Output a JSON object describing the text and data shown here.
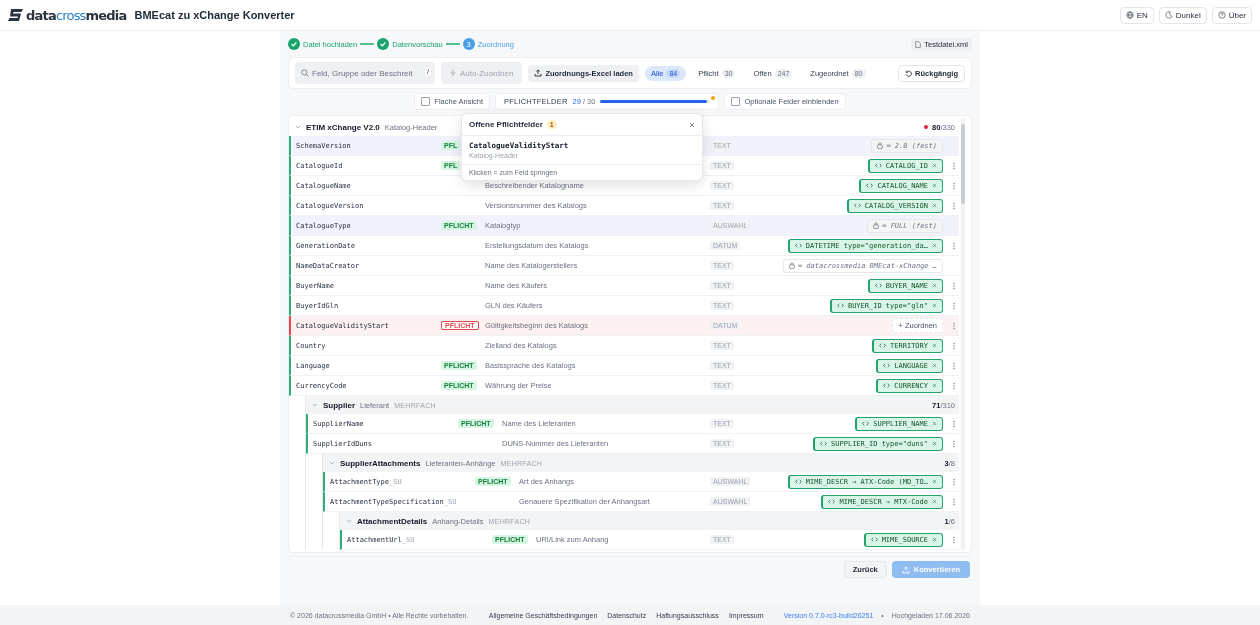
{
  "header": {
    "logo": [
      {
        "text": "data",
        "accent": false
      },
      {
        "text": "cross",
        "accent": true
      },
      {
        "text": "media",
        "accent": false
      }
    ],
    "title": "BMEcat zu xChange Konverter",
    "actions": [
      {
        "kind": "language",
        "label": "EN"
      },
      {
        "kind": "theme",
        "label": "Dunkel"
      },
      {
        "kind": "about",
        "label": "Über"
      }
    ]
  },
  "stepper": {
    "steps": [
      {
        "label": "Datei hochladen",
        "done": true
      },
      {
        "label": "Datenvorschau",
        "done": true
      },
      {
        "label": "Zuordnung",
        "number": "3",
        "done": false
      }
    ],
    "file": "Testdatei.xml"
  },
  "toolbar": {
    "search": {
      "placeholder": "Feld, Gruppe oder Beschreit",
      "shortcut": "/"
    },
    "auto_button": {
      "label": "Auto-Zuordnen",
      "disabled": true
    },
    "excel_button": "Zuordnungs-Excel laden",
    "filters": [
      {
        "label": "Alle",
        "count": "84",
        "selected": true
      },
      {
        "label": "Pflicht",
        "count": "30",
        "selected": false
      },
      {
        "label": "Offen",
        "count": "247",
        "selected": false
      },
      {
        "label": "Zugeordnet",
        "count": "80",
        "selected": false
      }
    ],
    "undo": "Rückgängig"
  },
  "options": {
    "flat_view": {
      "label": "Flache Ansicht",
      "checked": false
    },
    "progress": {
      "label": "PFLICHTFELDER",
      "done": "29",
      "total": "/ 30",
      "level": 0.967,
      "alert": true
    },
    "optional": {
      "label": "Optionale Felder einblenden",
      "checked": false
    }
  },
  "tree": {
    "kind": "group",
    "name": "ETIM xChange V2.0",
    "subtitle": "Katalog-Header",
    "done": "80",
    "total": "/330",
    "alert": true,
    "expanded": true,
    "children": [
      {
        "kind": "field",
        "name": "SchemaVersion",
        "badge": "PFL",
        "type": "TEXT",
        "mapping": {
          "kind": "fixed",
          "value": "= 2.0 (fest)"
        },
        "highlighted": true,
        "error": false
      },
      {
        "kind": "field",
        "name": "CatalogueId",
        "badge": "PFL",
        "type": "TEXT",
        "mapping": {
          "kind": "mapped",
          "value": "CATALOG_ID"
        },
        "highlighted": false,
        "error": false
      },
      {
        "kind": "field",
        "name": "CatalogueName",
        "description": "Beschreibender Katalogname",
        "type": "TEXT",
        "mapping": {
          "kind": "mapped",
          "value": "CATALOG_NAME"
        },
        "highlighted": false,
        "error": false
      },
      {
        "kind": "field",
        "name": "CatalogueVersion",
        "description": "Versionsnummer des Katalogs",
        "type": "TEXT",
        "mapping": {
          "kind": "mapped",
          "value": "CATALOG_VERSION"
        },
        "highlighted": false,
        "error": false
      },
      {
        "kind": "field",
        "name": "CatalogueType",
        "badge": "PFLICHT",
        "description": "Katalogtyp",
        "type": "AUSWAHL",
        "mapping": {
          "kind": "fixed",
          "value": "= FULL (fest)"
        },
        "highlighted": true,
        "error": false
      },
      {
        "kind": "field",
        "name": "GenerationDate",
        "description": "Erstellungsdatum des Katalogs",
        "type": "DATUM",
        "mapping": {
          "kind": "mapped",
          "value": "DATETIME type=\"generation_da…"
        },
        "highlighted": false,
        "error": false
      },
      {
        "kind": "field",
        "name": "NameDataCreator",
        "description": "Name des Katalogerstellers",
        "type": "TEXT",
        "mapping": {
          "kind": "fixed",
          "value": "= datacrossmedia BMEcat-xChange …"
        },
        "highlighted": false,
        "error": false
      },
      {
        "kind": "field",
        "name": "BuyerName",
        "description": "Name des Käufers",
        "type": "TEXT",
        "mapping": {
          "kind": "mapped",
          "value": "BUYER_NAME"
        },
        "highlighted": false,
        "error": false
      },
      {
        "kind": "field",
        "name": "BuyerIdGln",
        "description": "GLN des Käufers",
        "type": "TEXT",
        "mapping": {
          "kind": "mapped",
          "value": "BUYER_ID type=\"gln\""
        },
        "highlighted": false,
        "error": false
      },
      {
        "kind": "field",
        "name": "CatalogueValidityStart",
        "badge": "PFLICHT",
        "description": "Gültigkeitsbeginn des Katalogs",
        "type": "DATUM",
        "mapping": {
          "kind": "unmapped",
          "value": "+ Zuordnen"
        },
        "highlighted": false,
        "error": true
      },
      {
        "kind": "field",
        "name": "Country",
        "description": "Zielland des Katalogs",
        "type": "TEXT",
        "mapping": {
          "kind": "mapped",
          "value": "TERRITORY"
        },
        "highlighted": false,
        "error": false
      },
      {
        "kind": "field",
        "name": "Language",
        "badge": "PFLICHT",
        "description": "Basissprache des Katalogs",
        "type": "TEXT",
        "mapping": {
          "kind": "mapped",
          "value": "LANGUAGE"
        },
        "highlighted": false,
        "error": false
      },
      {
        "kind": "field",
        "name": "CurrencyCode",
        "badge": "PFLICHT",
        "description": "Währung der Preise",
        "type": "TEXT",
        "mapping": {
          "kind": "mapped",
          "value": "CURRENCY"
        },
        "highlighted": false,
        "error": false
      },
      {
        "kind": "group",
        "name": "Supplier",
        "subtitle": "Lieferant",
        "tag": "MEHRFACH",
        "done": "71",
        "total": "/310",
        "expanded": true,
        "children": [
          {
            "kind": "field",
            "name": "SupplierName",
            "badge": "PFLICHT",
            "description": "Name des Lieferanten",
            "type": "TEXT",
            "mapping": {
              "kind": "mapped",
              "value": "SUPPLIER_NAME"
            },
            "highlighted": false,
            "error": false
          },
          {
            "kind": "field",
            "name": "SupplierIdDuns",
            "description": "DUNS-Nummer des Lieferanten",
            "type": "TEXT",
            "mapping": {
              "kind": "mapped",
              "value": "SUPPLIER_ID type=\"duns\""
            },
            "highlighted": false,
            "error": false
          },
          {
            "kind": "group",
            "name": "SupplierAttachments",
            "subtitle": "Lieferanten-Anhänge",
            "tag": "MEHRFACH",
            "done": "3",
            "total": "/8",
            "expanded": true,
            "children": [
              {
                "kind": "field",
                "name": "AttachmentType",
                "suffix": "_SU",
                "badge": "PFLICHT",
                "description": "Art des Anhangs",
                "type": "AUSWAHL",
                "mapping": {
                  "kind": "mapped",
                  "value": "MIME_DESCR → ATX-Code (MD_TO…"
                },
                "highlighted": false,
                "error": false
              },
              {
                "kind": "field",
                "name": "AttachmentTypeSpecification",
                "suffix": "_SU",
                "description": "Genauere Spezifikation der Anhangsart",
                "type": "AUSWAHL",
                "mapping": {
                  "kind": "mapped",
                  "value": "MIME_DESCR → MTX-Code"
                },
                "highlighted": false,
                "error": false
              },
              {
                "kind": "group",
                "name": "AttachmentDetails",
                "subtitle": "Anhang-Details",
                "tag": "MEHRFACH",
                "done": "1",
                "total": "/6",
                "expanded": true,
                "children": [
                  {
                    "kind": "field",
                    "name": "AttachmentUrl",
                    "suffix": "_SU",
                    "badge": "PFLICHT",
                    "description": "URI/Link zum Anhang",
                    "type": "TEXT",
                    "mapping": {
                      "kind": "mapped",
                      "value": "MIME_SOURCE"
                    },
                    "highlighted": false,
                    "error": false
                  }
                ]
              }
            ]
          }
        ]
      }
    ]
  },
  "popover": {
    "title": "Offene Pflichtfelder",
    "count": "1",
    "items": [
      {
        "field": "CatalogueValidityStart",
        "group": "Katalog-Header"
      }
    ],
    "hint": "Klicken = zum Feld springen"
  },
  "actions": {
    "back": "Zurück",
    "convert": {
      "label": "Konvertieren",
      "disabled": true
    }
  },
  "footer": {
    "copyright": "© 2026 datacrossmedia GmbH • Alle Rechte vorbehalten.",
    "links": [
      "Allgemeine Geschäftsbedingungen",
      "Datenschutz",
      "Haftungsausschluss",
      "Impressum"
    ],
    "version": "Version 0.7.0-rc3-build26251",
    "separator": "•",
    "uploaded": "Hochgeladen 17.06.2026"
  }
}
